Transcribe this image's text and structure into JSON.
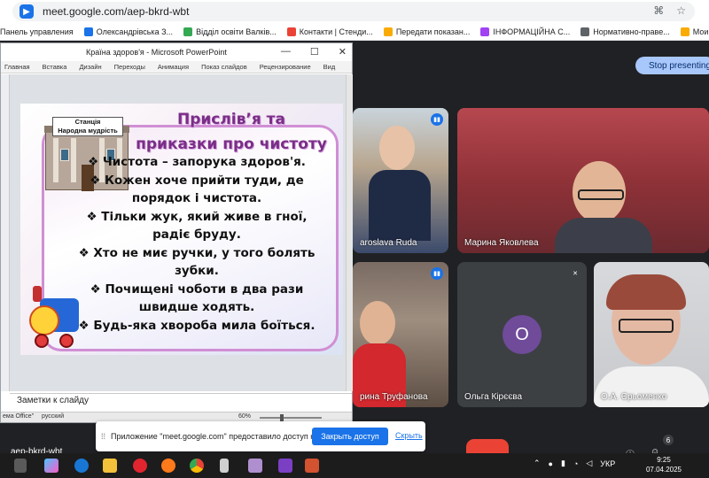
{
  "browser": {
    "url": "meet.google.com/aep-bkrd-wbt",
    "bookmarks": [
      {
        "label": "Панель управления",
        "color": "#5f6368"
      },
      {
        "label": "Олександрівська З...",
        "color": "#1a73e8"
      },
      {
        "label": "Відділ освіти Валків...",
        "color": "#34a853"
      },
      {
        "label": "Контакти | Стенди...",
        "color": "#ea4335"
      },
      {
        "label": "Передати показан...",
        "color": "#f9ab00"
      },
      {
        "label": "ІНФОРМАЦІЙНА С...",
        "color": "#a142f4"
      },
      {
        "label": "Нормативно-праве...",
        "color": "#5f6368"
      },
      {
        "label": "Мои данные / 104.ua",
        "color": "#f9ab00"
      }
    ]
  },
  "meet": {
    "stop_presenting": "Stop presenting",
    "meeting_code": "aep-bkrd-wbt",
    "participants_count": "6",
    "participants": [
      {
        "name": "aroslava Ruda",
        "mic": "active"
      },
      {
        "name": "Марина Яковлева",
        "mic": "none"
      },
      {
        "name": "рина Труфанова",
        "mic": "active"
      },
      {
        "name": "Ольга Кірєєва",
        "mic": "muted",
        "avatar_letter": "О"
      },
      {
        "name": "О.А. Єрьоменко",
        "mic": "none"
      }
    ]
  },
  "share_notice": {
    "text": "Приложение \"meet.google.com\" предоставило доступ к окну.",
    "button": "Закрыть доступ",
    "hide": "Скрыть"
  },
  "powerpoint": {
    "window_title": "Країна здоров'я - Microsoft PowerPoint",
    "ribbon_tabs": [
      "Главная",
      "Вставка",
      "Дизайн",
      "Переходы",
      "Анимация",
      "Показ слайдов",
      "Рецензирование",
      "Вид"
    ],
    "slide": {
      "station_label": "Станція\nНародна мудрість",
      "title": "Прислів’я та приказки про чистоту",
      "lines": [
        "❖ Чистота – запорука здоров'я.",
        "❖ Кожен хоче прийти туди, де порядок і чистота.",
        "❖ Тільки жук, який живе в гної, радіє бруду.",
        "❖ Хто не миє ручки, у того болять зубки.",
        "❖ Почищені чоботи в два рази швидше ходять.",
        "❖ Будь-яка хвороба мила боїться."
      ]
    },
    "notes_placeholder": "Заметки к слайду",
    "status": {
      "theme": "ема Office\"",
      "language": "русский",
      "zoom": "60%"
    }
  },
  "taskbar": {
    "language": "УКР",
    "time": "9:25",
    "date": "07.04.2025"
  }
}
